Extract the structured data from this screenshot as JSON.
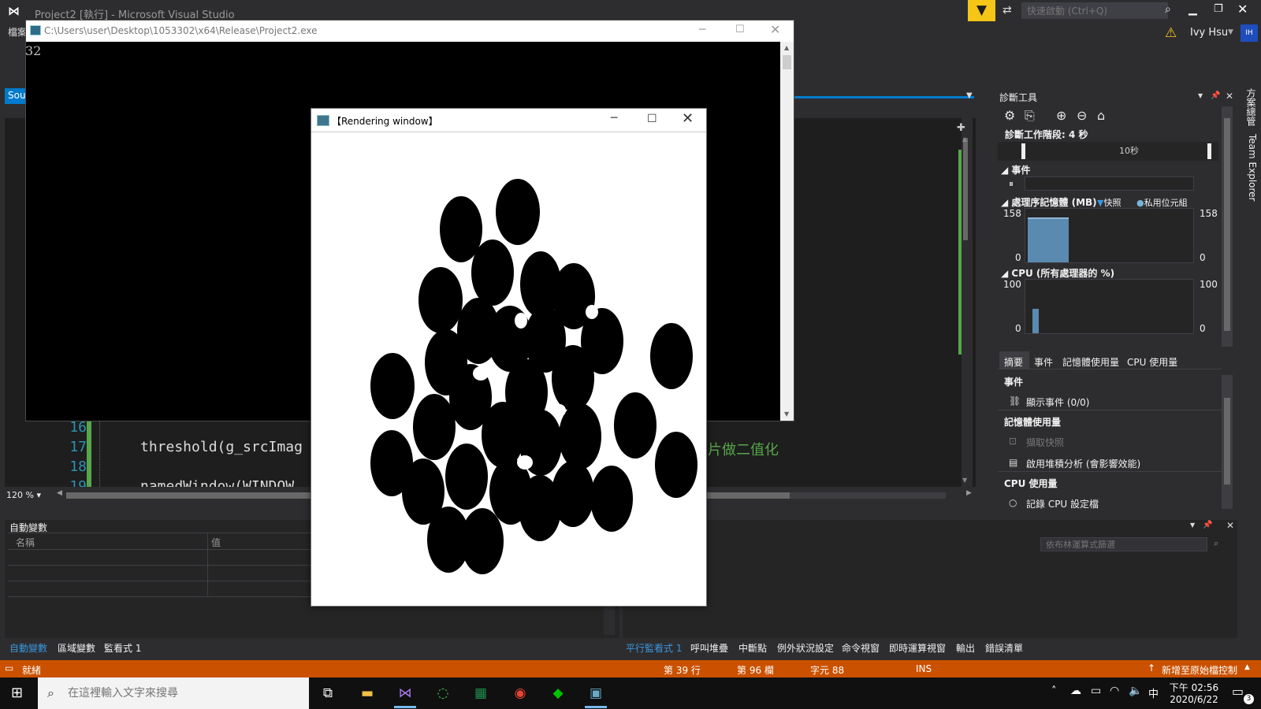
{
  "titlebar": {
    "title": "Project2 [執行] - Microsoft Visual Studio",
    "quick_launch_placeholder": "快速啟動 (Ctrl+Q)",
    "user_name": "Ivy Hsu",
    "avatar_initials": "IH"
  },
  "menu": {
    "file_label": "檔案"
  },
  "side_tabs": {
    "source_label": "Sou",
    "solution_label": "方案總管",
    "team_label": "Team Explorer"
  },
  "editor": {
    "zoom": "120 %",
    "lines": [
      {
        "num": "16",
        "code": ""
      },
      {
        "num": "17",
        "code": "threshold(g_srcImag"
      },
      {
        "num": "18",
        "code": ""
      },
      {
        "num": "19",
        "code": "namedWindow(WINDOW_"
      }
    ],
    "comment_fragment": "圖片做二值化"
  },
  "autos": {
    "title": "自動變數",
    "col_name": "名稱",
    "col_value": "值",
    "tabs": [
      {
        "label": "自動變數",
        "active": true
      },
      {
        "label": "區域變數",
        "active": false
      },
      {
        "label": "監看式 1",
        "active": false
      }
    ]
  },
  "watch": {
    "filter_placeholder": "依布林運算式篩選",
    "tabs": [
      {
        "label": "平行監看式 1",
        "active": true
      },
      {
        "label": "呼叫堆疊",
        "active": false
      },
      {
        "label": "中斷點",
        "active": false
      },
      {
        "label": "例外狀況設定",
        "active": false
      },
      {
        "label": "命令視窗",
        "active": false
      },
      {
        "label": "即時運算視窗",
        "active": false
      },
      {
        "label": "輸出",
        "active": false
      },
      {
        "label": "錯誤清單",
        "active": false
      }
    ]
  },
  "diagnostics": {
    "title": "診斷工具",
    "session": "診斷工作階段: 4 秒",
    "timeline_label": "10秒",
    "events_section": "事件",
    "memory_section": "處理序記憶體 (MB)",
    "legend_snapshot": "快照",
    "legend_private": "私用位元組",
    "memory_max": "158",
    "memory_min": "0",
    "cpu_section": "CPU (所有處理器的 %)",
    "cpu_max": "100",
    "cpu_min": "0",
    "tabs": [
      "摘要",
      "事件",
      "記憶體使用量",
      "CPU 使用量"
    ],
    "summary": {
      "events_head": "事件",
      "show_events": "顯示事件 (0/0)",
      "memory_head": "記憶體使用量",
      "take_snapshot": "擷取快照",
      "heap_analysis": "啟用堆積分析 (會影響效能)",
      "cpu_head": "CPU 使用量",
      "record_cpu": "記錄 CPU 設定檔"
    }
  },
  "statusbar": {
    "ready": "就緒",
    "line": "第 39 行",
    "column": "第 96 欄",
    "char": "字元 88",
    "mode": "INS",
    "source_control": "新增至原始檔控制"
  },
  "console": {
    "title": "C:\\Users\\user\\Desktop\\1053302\\x64\\Release\\Project2.exe",
    "output": "32"
  },
  "render_window": {
    "title": "【Rendering window】"
  },
  "taskbar": {
    "search_placeholder": "在這裡輸入文字來搜尋",
    "time": "下午 02:56",
    "date": "2020/6/22",
    "ime": "中",
    "notification_count": "3"
  }
}
